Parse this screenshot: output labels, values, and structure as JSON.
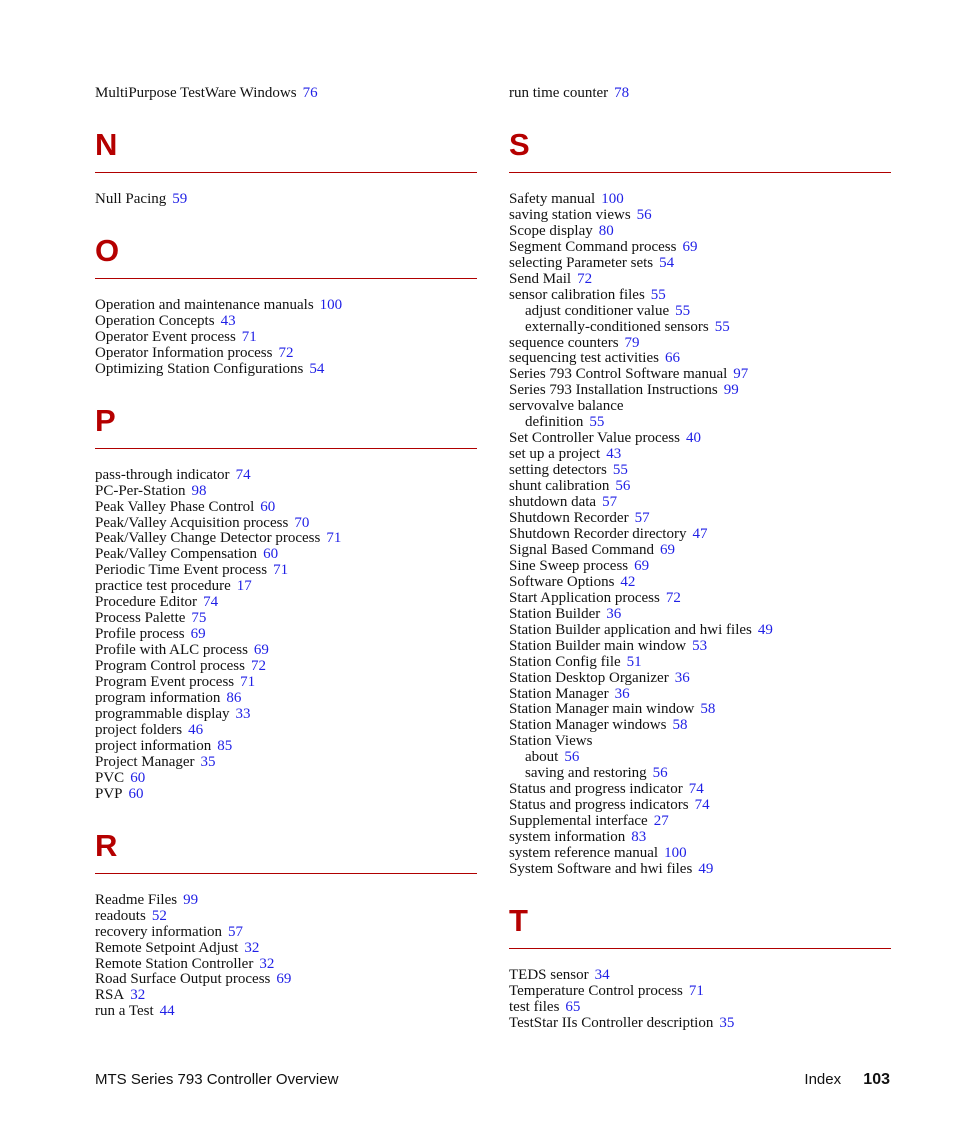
{
  "left_column": [
    {
      "type": "entries",
      "items": [
        {
          "term": "MultiPurpose TestWare Windows",
          "page": "76"
        }
      ]
    },
    {
      "type": "letter",
      "letter": "N",
      "items": [
        {
          "term": "Null Pacing",
          "page": "59"
        }
      ]
    },
    {
      "type": "letter",
      "letter": "O",
      "items": [
        {
          "term": "Operation and maintenance manuals",
          "page": "100"
        },
        {
          "term": "Operation Concepts",
          "page": "43"
        },
        {
          "term": "Operator Event process",
          "page": "71"
        },
        {
          "term": "Operator Information process",
          "page": "72"
        },
        {
          "term": "Optimizing Station Configurations",
          "page": "54"
        }
      ]
    },
    {
      "type": "letter",
      "letter": "P",
      "items": [
        {
          "term": "pass-through indicator",
          "page": "74"
        },
        {
          "term": "PC-Per-Station",
          "page": "98"
        },
        {
          "term": "Peak Valley Phase Control",
          "page": "60"
        },
        {
          "term": "Peak/Valley Acquisition process",
          "page": "70"
        },
        {
          "term": "Peak/Valley Change Detector process",
          "page": "71"
        },
        {
          "term": "Peak/Valley Compensation",
          "page": "60"
        },
        {
          "term": "Periodic Time Event process",
          "page": "71"
        },
        {
          "term": "practice test procedure",
          "page": "17"
        },
        {
          "term": "Procedure Editor",
          "page": "74"
        },
        {
          "term": "Process Palette",
          "page": "75"
        },
        {
          "term": "Profile process",
          "page": "69"
        },
        {
          "term": "Profile with ALC process",
          "page": "69"
        },
        {
          "term": "Program Control process",
          "page": "72"
        },
        {
          "term": "Program Event process",
          "page": "71"
        },
        {
          "term": "program information",
          "page": "86"
        },
        {
          "term": "programmable display",
          "page": "33"
        },
        {
          "term": "project folders",
          "page": "46"
        },
        {
          "term": "project information",
          "page": "85"
        },
        {
          "term": "Project Manager",
          "page": "35"
        },
        {
          "term": "PVC",
          "page": "60"
        },
        {
          "term": "PVP",
          "page": "60"
        }
      ]
    },
    {
      "type": "letter",
      "letter": "R",
      "items": [
        {
          "term": "Readme Files",
          "page": "99"
        },
        {
          "term": "readouts",
          "page": "52"
        },
        {
          "term": "recovery information",
          "page": "57"
        },
        {
          "term": "Remote Setpoint Adjust",
          "page": "32"
        },
        {
          "term": "Remote Station Controller",
          "page": "32"
        },
        {
          "term": "Road Surface Output process",
          "page": "69"
        },
        {
          "term": "RSA",
          "page": "32"
        },
        {
          "term": "run a Test",
          "page": "44"
        }
      ]
    }
  ],
  "right_column": [
    {
      "type": "entries",
      "items": [
        {
          "term": "run time counter",
          "page": "78"
        }
      ]
    },
    {
      "type": "letter",
      "letter": "S",
      "items": [
        {
          "term": "Safety manual",
          "page": "100"
        },
        {
          "term": "saving station views",
          "page": "56"
        },
        {
          "term": "Scope display",
          "page": "80"
        },
        {
          "term": "Segment Command process",
          "page": "69"
        },
        {
          "term": "selecting Parameter sets",
          "page": "54"
        },
        {
          "term": "Send Mail",
          "page": "72"
        },
        {
          "term": "sensor calibration files",
          "page": "55"
        },
        {
          "term": "adjust conditioner value",
          "page": "55",
          "sub": true
        },
        {
          "term": "externally-conditioned sensors",
          "page": "55",
          "sub": true
        },
        {
          "term": "sequence counters",
          "page": "79"
        },
        {
          "term": "sequencing test activities",
          "page": "66"
        },
        {
          "term": "Series 793 Control Software manual",
          "page": "97"
        },
        {
          "term": "Series 793 Installation Instructions",
          "page": "99"
        },
        {
          "term": "servovalve balance",
          "page": null
        },
        {
          "term": "definition",
          "page": "55",
          "sub": true
        },
        {
          "term": "Set Controller Value process",
          "page": "40"
        },
        {
          "term": "set up a project",
          "page": "43"
        },
        {
          "term": "setting detectors",
          "page": "55"
        },
        {
          "term": "shunt calibration",
          "page": "56"
        },
        {
          "term": "shutdown data",
          "page": "57"
        },
        {
          "term": "Shutdown Recorder",
          "page": "57"
        },
        {
          "term": "Shutdown Recorder directory",
          "page": "47"
        },
        {
          "term": "Signal Based Command",
          "page": "69"
        },
        {
          "term": "Sine Sweep process",
          "page": "69"
        },
        {
          "term": "Software Options",
          "page": "42"
        },
        {
          "term": "Start Application process",
          "page": "72"
        },
        {
          "term": "Station Builder",
          "page": "36"
        },
        {
          "term": "Station Builder application and hwi files",
          "page": "49"
        },
        {
          "term": "Station Builder main window",
          "page": "53"
        },
        {
          "term": "Station Config file",
          "page": "51"
        },
        {
          "term": "Station Desktop Organizer",
          "page": "36"
        },
        {
          "term": "Station Manager",
          "page": "36"
        },
        {
          "term": "Station Manager main window",
          "page": "58"
        },
        {
          "term": "Station Manager windows",
          "page": "58"
        },
        {
          "term": "Station Views",
          "page": null
        },
        {
          "term": "about",
          "page": "56",
          "sub": true
        },
        {
          "term": "saving and restoring",
          "page": "56",
          "sub": true
        },
        {
          "term": "Status and progress indicator",
          "page": "74"
        },
        {
          "term": "Status and progress indicators",
          "page": "74"
        },
        {
          "term": "Supplemental interface",
          "page": "27"
        },
        {
          "term": "system information",
          "page": "83"
        },
        {
          "term": "system reference manual",
          "page": "100"
        },
        {
          "term": "System Software and hwi files",
          "page": "49"
        }
      ]
    },
    {
      "type": "letter",
      "letter": "T",
      "items": [
        {
          "term": "TEDS sensor",
          "page": "34"
        },
        {
          "term": "Temperature Control process",
          "page": "71"
        },
        {
          "term": "test files",
          "page": "65"
        },
        {
          "term": "TestStar IIs Controller description",
          "page": "35"
        }
      ]
    }
  ],
  "footer": {
    "document_title": "MTS Series 793 Controller Overview",
    "section": "Index",
    "page_number": "103"
  },
  "colors": {
    "heading": "#b50000",
    "rule": "#b00000",
    "page_link": "#1f1fe6",
    "text": "#111111"
  }
}
